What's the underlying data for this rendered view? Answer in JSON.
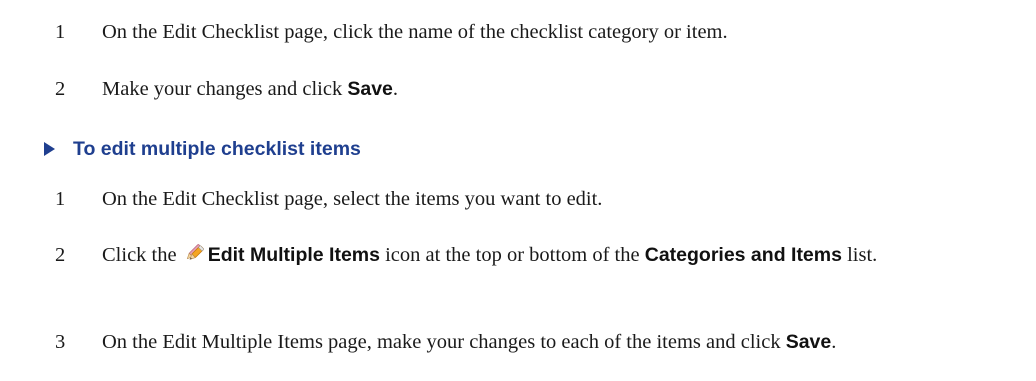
{
  "section1": {
    "steps": [
      {
        "number": "1",
        "text": "On the Edit Checklist page, click the name of the checklist category or item."
      },
      {
        "number": "2",
        "text_before": "Make your changes and click ",
        "ui_term": "Save",
        "text_after": "."
      }
    ]
  },
  "procedure": {
    "title": "To edit multiple checklist items",
    "steps": [
      {
        "number": "1",
        "text": "On the Edit Checklist page, select the items you want to edit."
      },
      {
        "number": "2",
        "text_before": "Click the ",
        "icon": "edit-multiple-items-icon",
        "ui_term_1": "Edit Multiple Items",
        "text_middle": " icon at the top or bottom of the ",
        "ui_term_2": "Categories and Items",
        "text_after": " list."
      },
      {
        "number": "3",
        "text_before": "On the Edit Multiple Items page, make your changes to each of the items and click ",
        "ui_term": "Save",
        "text_after": "."
      }
    ]
  },
  "colors": {
    "heading": "#1f3f8f",
    "body_text": "#1a1a1a"
  }
}
